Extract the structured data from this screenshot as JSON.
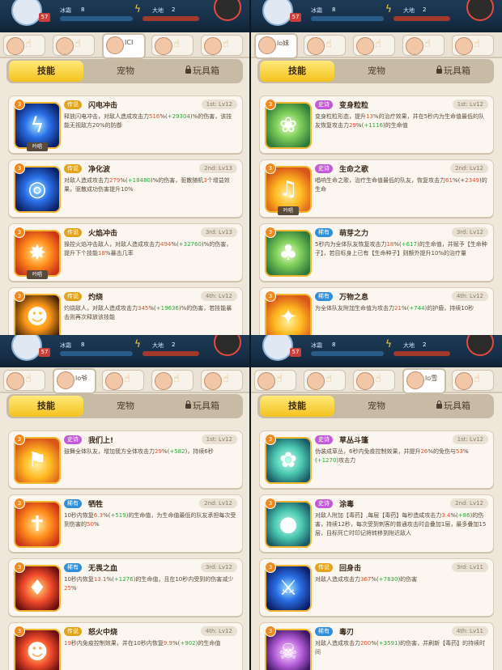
{
  "panels": [
    {
      "hero_name": "ICI",
      "tabs": {
        "skills": "技能",
        "pets": "宠物",
        "toys": "玩具箱"
      },
      "status": {
        "level": "57",
        "frost": "冰霜",
        "frost_val": "8",
        "earth": "大地",
        "earth_val": "2"
      },
      "skills": [
        {
          "badge": "3",
          "rarity": "传说",
          "rarity_class": "legend",
          "name": "闪电冲击",
          "level": "1st: Lv12",
          "chant": "吟唱",
          "icon_bg": "bg-blue",
          "icon": "ϟ",
          "desc_parts": [
            "释放闪电冲击，对敌人造成攻击力",
            "516",
            "%(",
            "+29304",
            ")%的伤害，该技能无视敌方20%的防御"
          ]
        },
        {
          "badge": "3",
          "rarity": "传说",
          "rarity_class": "legend",
          "name": "净化波",
          "level": "2nd: Lv13",
          "chant": "",
          "icon_bg": "bg-blue",
          "icon": "◎",
          "desc_parts": [
            "对敌人造成攻击力",
            "279",
            "%(",
            "+18480",
            ")%的伤害，驱散随机",
            "3",
            "个增益效果，驱散成功伤害提升10%"
          ]
        },
        {
          "badge": "3",
          "rarity": "传说",
          "rarity_class": "legend",
          "name": "火焰冲击",
          "level": "3rd: Lv13",
          "chant": "吟唱",
          "icon_bg": "bg-orange",
          "icon": "✸",
          "desc_parts": [
            "操控火焰冲击敌人，对敌人造成攻击力",
            "494",
            "%(",
            "+32760",
            ")%的伤害，提升下个技能",
            "18",
            "%暴击几率"
          ]
        },
        {
          "badge": "3",
          "rarity": "传说",
          "rarity_class": "legend",
          "name": "灼烧",
          "level": "4th: Lv12",
          "chant": "",
          "icon_bg": "bg-dark",
          "icon": "☻",
          "desc_parts": [
            "灼烧敌人，对敌人造成攻击力",
            "345",
            "%(",
            "+19636",
            ")%的伤害，若技能暴击则再次释放该技能"
          ]
        }
      ]
    },
    {
      "hero_name": "lo妹",
      "tabs": {
        "skills": "技能",
        "pets": "宠物",
        "toys": "玩具箱"
      },
      "status": {
        "level": "57",
        "frost": "冰霜",
        "frost_val": "8",
        "earth": "大地",
        "earth_val": "2"
      },
      "skills": [
        {
          "badge": "3",
          "rarity": "史诗",
          "rarity_class": "epic",
          "name": "变身粒粒",
          "level": "1st: Lv12",
          "chant": "",
          "icon_bg": "bg-green",
          "icon": "❀",
          "desc_parts": [
            "变身粒粒形态，提升",
            "13",
            "%的治疗效果，并在5秒内为生命值最低的队友恢复攻击力",
            "29",
            "%(",
            "+1116",
            ")的生命值"
          ]
        },
        {
          "badge": "3",
          "rarity": "史诗",
          "rarity_class": "epic",
          "name": "生命之歌",
          "level": "2nd: Lv12",
          "chant": "吟唱",
          "icon_bg": "bg-yellow",
          "icon": "♫",
          "desc_parts": [
            "唱响生命之歌，治疗生命值最低的队友，恢复攻击力",
            "61",
            "%(+",
            "2349",
            ")的生命"
          ]
        },
        {
          "badge": "3",
          "rarity": "稀有",
          "rarity_class": "rare",
          "name": "萌芽之力",
          "level": "3rd: Lv12",
          "chant": "",
          "icon_bg": "bg-green",
          "icon": "♣",
          "desc_parts": [
            "5秒内为全体队友恢复攻击力",
            "18",
            "%(",
            "+617",
            ")的生命值，并赋予【生命种子】，若目标身上已有【生命种子】则额外提升10%的治疗量"
          ]
        },
        {
          "badge": "3",
          "rarity": "稀有",
          "rarity_class": "rare",
          "name": "万物之息",
          "level": "4th: Lv12",
          "chant": "",
          "icon_bg": "bg-yellow",
          "icon": "✦",
          "desc_parts": [
            "为全体队友附加生命值为攻击力",
            "21",
            "%(",
            "+744",
            ")的护盾，持续10秒"
          ]
        }
      ]
    },
    {
      "hero_name": "lo爷",
      "tabs": {
        "skills": "技能",
        "pets": "宠物",
        "toys": "玩具箱"
      },
      "status": {
        "level": "57",
        "frost": "冰霜",
        "frost_val": "8",
        "earth": "大地",
        "earth_val": "2"
      },
      "skills": [
        {
          "badge": "3",
          "rarity": "史诗",
          "rarity_class": "epic",
          "name": "我们上!",
          "level": "1st: Lv12",
          "chant": "",
          "icon_bg": "bg-yellow",
          "icon": "⚑",
          "desc_parts": [
            "鼓舞全体队友，增加我方全体攻击力",
            "29",
            "%(",
            "+582",
            ")，持续6秒"
          ]
        },
        {
          "badge": "3",
          "rarity": "稀有",
          "rarity_class": "rare",
          "name": "牺牲",
          "level": "2nd: Lv12",
          "chant": "",
          "icon_bg": "bg-orange",
          "icon": "✝",
          "desc_parts": [
            "10秒内恢复",
            "6.3",
            "%(",
            "+519",
            ")的生命值，为生命值最低的队友承担每次受到伤害的",
            "50",
            "%"
          ]
        },
        {
          "badge": "3",
          "rarity": "稀有",
          "rarity_class": "rare",
          "name": "无畏之血",
          "level": "3rd: Lv12",
          "chant": "",
          "icon_bg": "bg-red",
          "icon": "♦",
          "desc_parts": [
            "10秒内恢复",
            "13.1",
            "%(",
            "+1276",
            ")的生命值，且在10秒内受到的伤害减少",
            "25",
            "%"
          ]
        },
        {
          "badge": "3",
          "rarity": "传说",
          "rarity_class": "legend",
          "name": "怒火中烧",
          "level": "4th: Lv12",
          "chant": "",
          "icon_bg": "bg-red",
          "icon": "☻",
          "desc_parts": [
            "",
            "19",
            "秒内免疫控制效果，并在10秒内恢复",
            "9.9",
            "%(",
            "+902",
            ")的生命值"
          ]
        }
      ]
    },
    {
      "hero_name": "lo雪",
      "tabs": {
        "skills": "技能",
        "pets": "宠物",
        "toys": "玩具箱"
      },
      "status": {
        "level": "57",
        "frost": "冰霜",
        "frost_val": "8",
        "earth": "大地",
        "earth_val": "2"
      },
      "skills": [
        {
          "badge": "3",
          "rarity": "史诗",
          "rarity_class": "epic",
          "name": "草丛斗篷",
          "level": "1st: Lv12",
          "chant": "",
          "icon_bg": "bg-teal",
          "icon": "✿",
          "desc_parts": [
            "伪装成草丛，6秒内免疫控制效果，并提升",
            "26",
            "%的免伤与",
            "53",
            "%(",
            "+1270",
            ")攻击力"
          ]
        },
        {
          "badge": "3",
          "rarity": "史诗",
          "rarity_class": "epic",
          "name": "涂毒",
          "level": "2nd: Lv12",
          "chant": "",
          "icon_bg": "bg-teal",
          "icon": "●",
          "desc_parts": [
            "对敌人附加【毒药】,每层【毒药】每秒造成攻击力",
            "3.4",
            "%(",
            "+86",
            ")的伤害，持续12秒，每次受到刺客的普通攻击时会叠加1层，最多叠加15层，目标死亡时印记将转移到附近敌人"
          ]
        },
        {
          "badge": "3",
          "rarity": "传说",
          "rarity_class": "legend",
          "name": "回身击",
          "level": "3rd: Lv11",
          "chant": "",
          "icon_bg": "bg-blue",
          "icon": "⚔",
          "desc_parts": [
            "对敌人造成攻击力",
            "367",
            "%(",
            "+7830",
            ")的伤害"
          ]
        },
        {
          "badge": "3",
          "rarity": "稀有",
          "rarity_class": "rare",
          "name": "毒刃",
          "level": "4th: Lv11",
          "chant": "",
          "icon_bg": "bg-purple",
          "icon": "☠",
          "desc_parts": [
            "对敌人造成攻击力",
            "200",
            "%(",
            "+3591",
            ")的伤害，并刷新【毒药】的持续时间"
          ]
        }
      ]
    }
  ]
}
